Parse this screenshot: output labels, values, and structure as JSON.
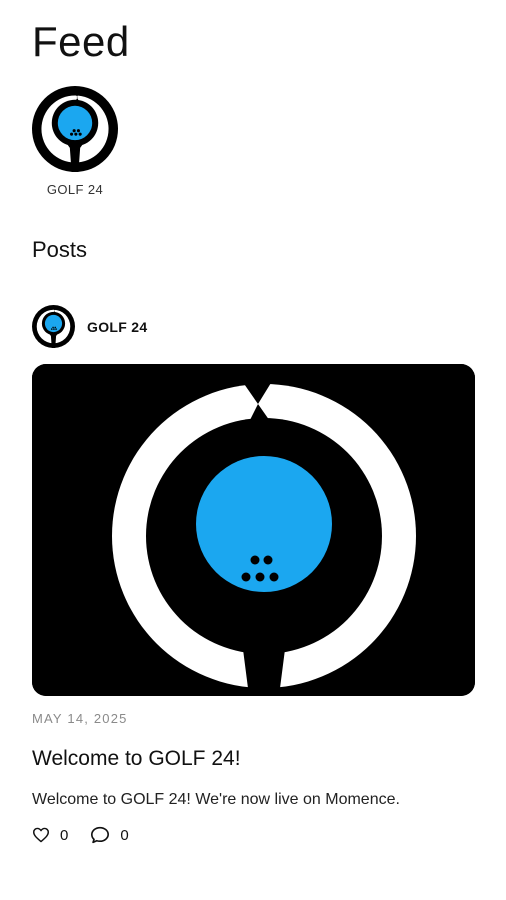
{
  "header": {
    "title": "Feed"
  },
  "stories": [
    {
      "label": "GOLF 24"
    }
  ],
  "section": {
    "title": "Posts"
  },
  "post": {
    "author": "GOLF 24",
    "date": "MAY 14, 2025",
    "title": "Welcome to GOLF 24!",
    "body": "Welcome to GOLF 24! We're now live on Momence.",
    "likes": "0",
    "comments": "0",
    "image_icon": "golf-24-logo"
  },
  "colors": {
    "brand_blue": "#1BA7F0",
    "logo_black": "#000000",
    "background": "#ffffff",
    "muted_text": "#8a8a8a"
  },
  "icons": {
    "like": "heart-icon",
    "comment": "comment-icon"
  }
}
